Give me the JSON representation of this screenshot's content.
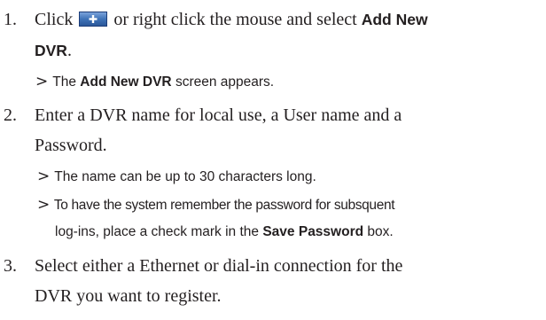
{
  "steps": [
    {
      "number": "1.",
      "parts": {
        "click": "Click",
        "after_icon": "or right click the mouse and select",
        "add_new": "Add New",
        "dvr": "DVR",
        "period": "."
      },
      "icon": "add-button-icon",
      "notes": [
        {
          "marker": ">",
          "prefix": "The",
          "bold": "Add New DVR",
          "suffix": "screen appears."
        }
      ]
    },
    {
      "number": "2.",
      "lines": [
        "Enter a DVR name for local use, a User name and a",
        "Password."
      ],
      "notes": [
        {
          "marker": ">",
          "text": "The name can be up to 30 characters long."
        },
        {
          "marker": ">",
          "line1": "To have the system remember the password for subsquent",
          "line2_prefix": "log-ins, place a check mark in the",
          "line2_bold": "Save Password",
          "line2_suffix": "box."
        }
      ]
    },
    {
      "number": "3.",
      "lines": [
        "Select either a Ethernet or dial-in connection for the",
        "DVR you want to register."
      ]
    }
  ],
  "colors": {
    "text": "#231f20",
    "icon_fill": "#3f73b8",
    "icon_border": "#1d3d78",
    "icon_plus": "#ffffff"
  }
}
